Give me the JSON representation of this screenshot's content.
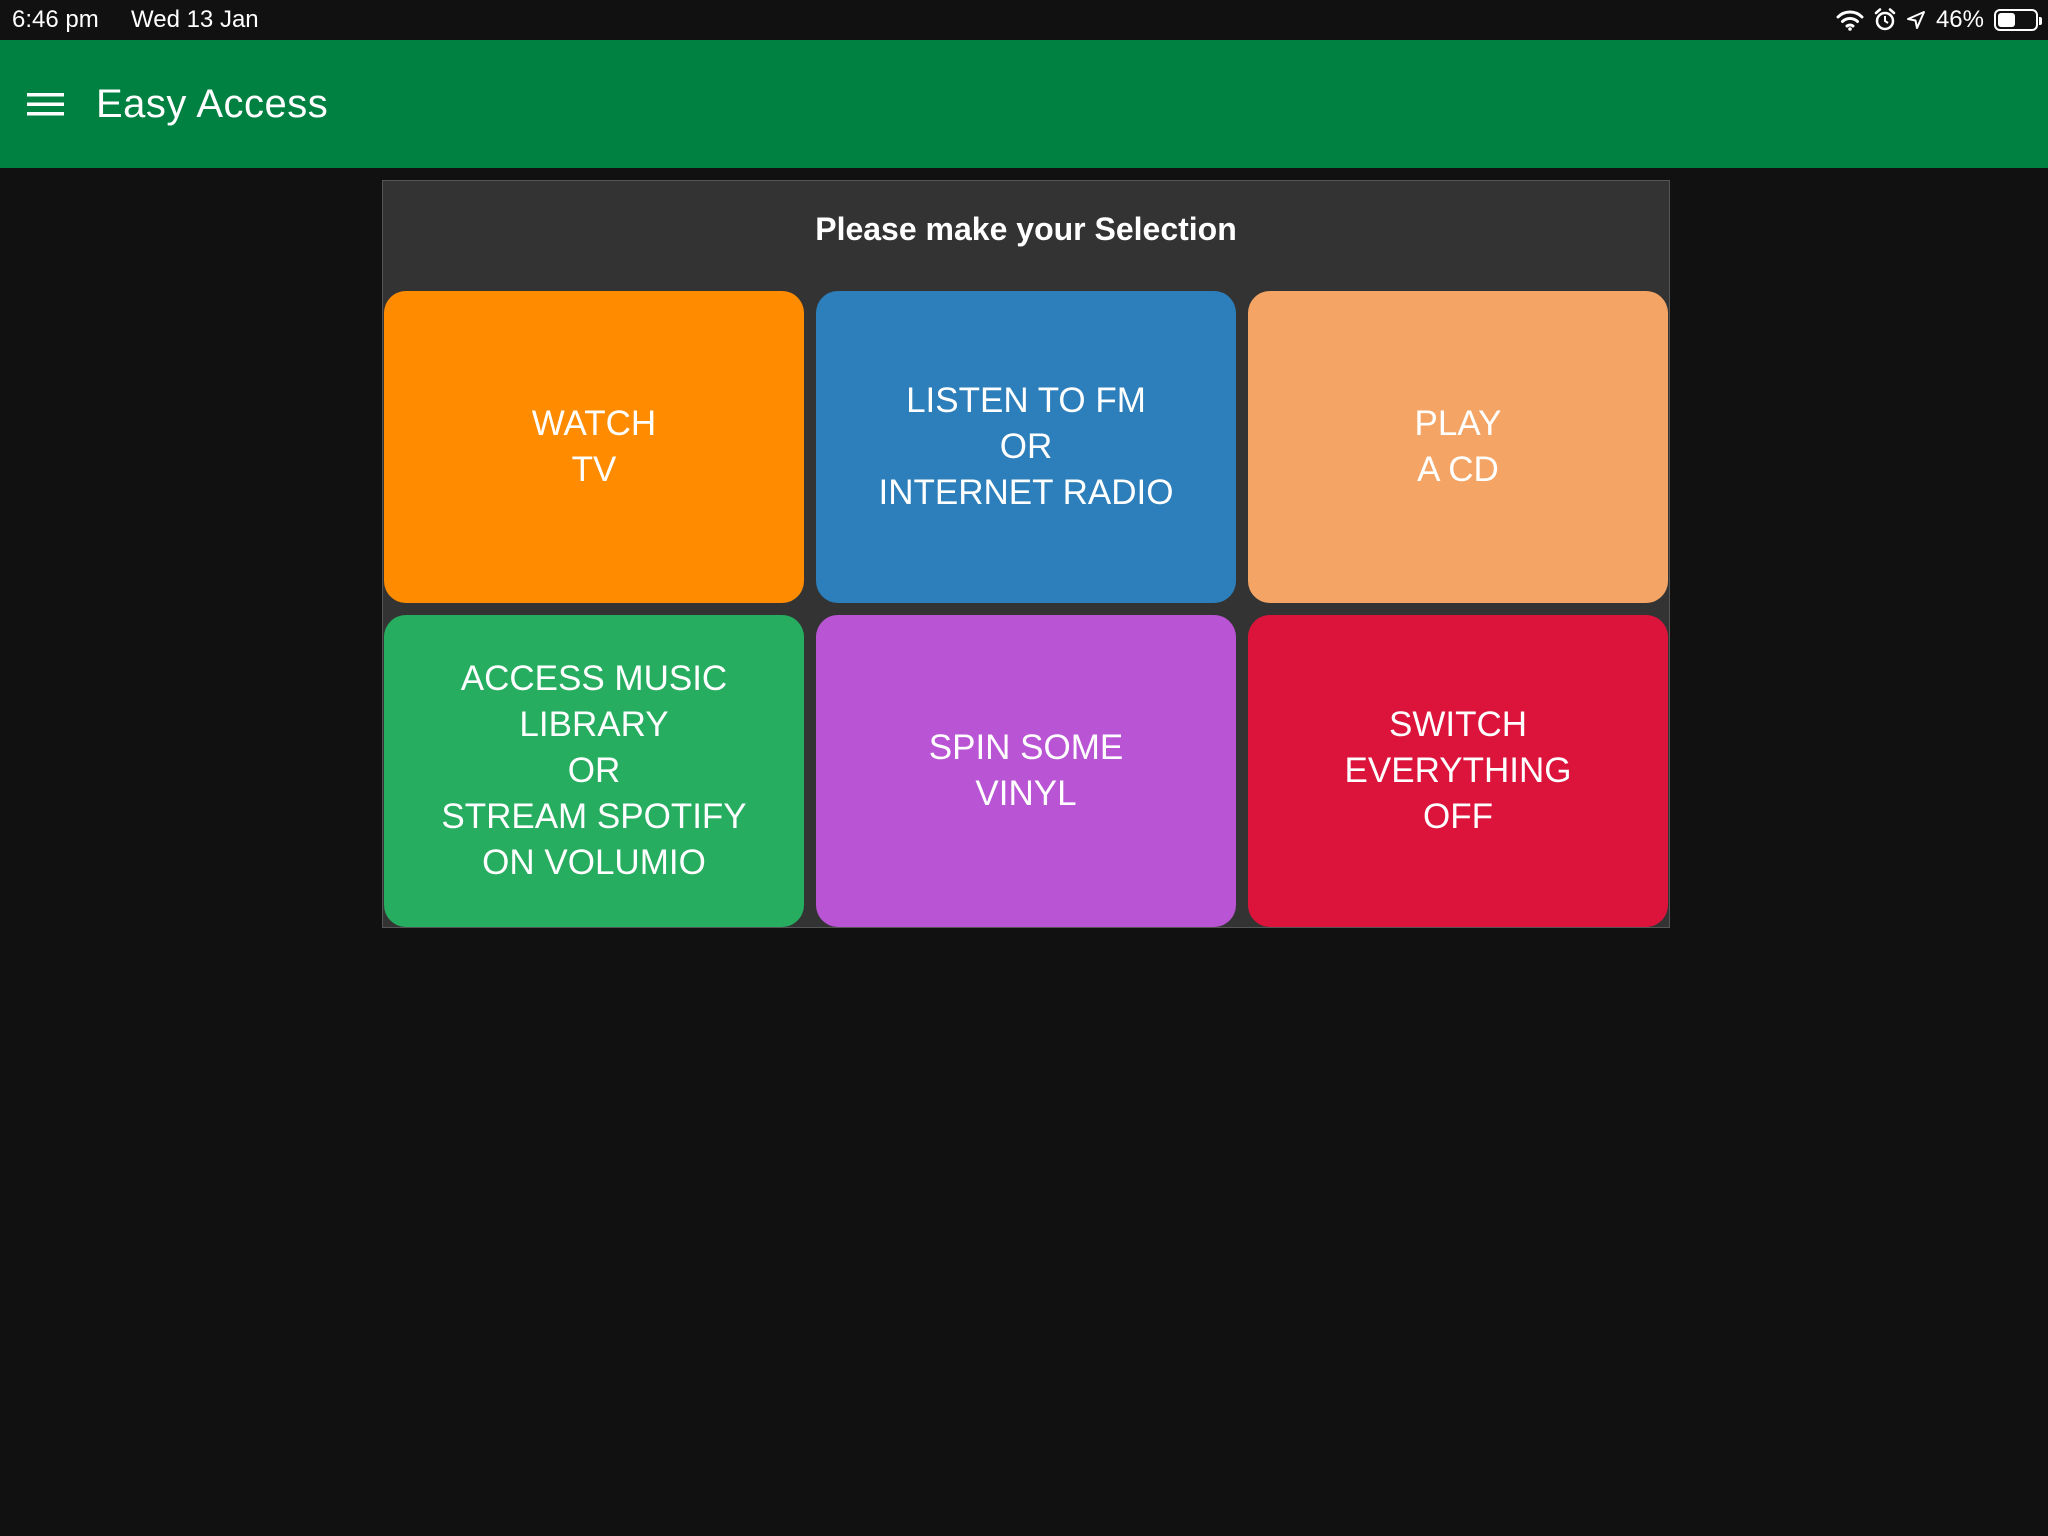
{
  "status_bar": {
    "time": "6:46 pm",
    "date": "Wed 13 Jan",
    "battery_percent": "46%",
    "battery_level": 0.46,
    "icons": [
      "wifi-icon",
      "alarm-icon",
      "location-arrow-icon",
      "battery-icon"
    ]
  },
  "app_bar": {
    "title": "Easy Access",
    "menu_icon": "hamburger-menu-icon",
    "color": "#008041"
  },
  "panel": {
    "title": "Please make your Selection",
    "tiles": [
      {
        "label": "WATCH\nTV",
        "color": "#FF8C00"
      },
      {
        "label": "LISTEN TO FM\nOR\nINTERNET RADIO",
        "color": "#2C7FBA"
      },
      {
        "label": "PLAY\nA CD",
        "color": "#F4A464"
      },
      {
        "label": "ACCESS MUSIC\nLIBRARY\nOR\nSTREAM SPOTIFY\nON VOLUMIO",
        "color": "#27AD60"
      },
      {
        "label": "SPIN SOME\nVINYL",
        "color": "#B955D4"
      },
      {
        "label": "SWITCH\nEVERYTHING\nOFF",
        "color": "#DC143C"
      }
    ]
  }
}
